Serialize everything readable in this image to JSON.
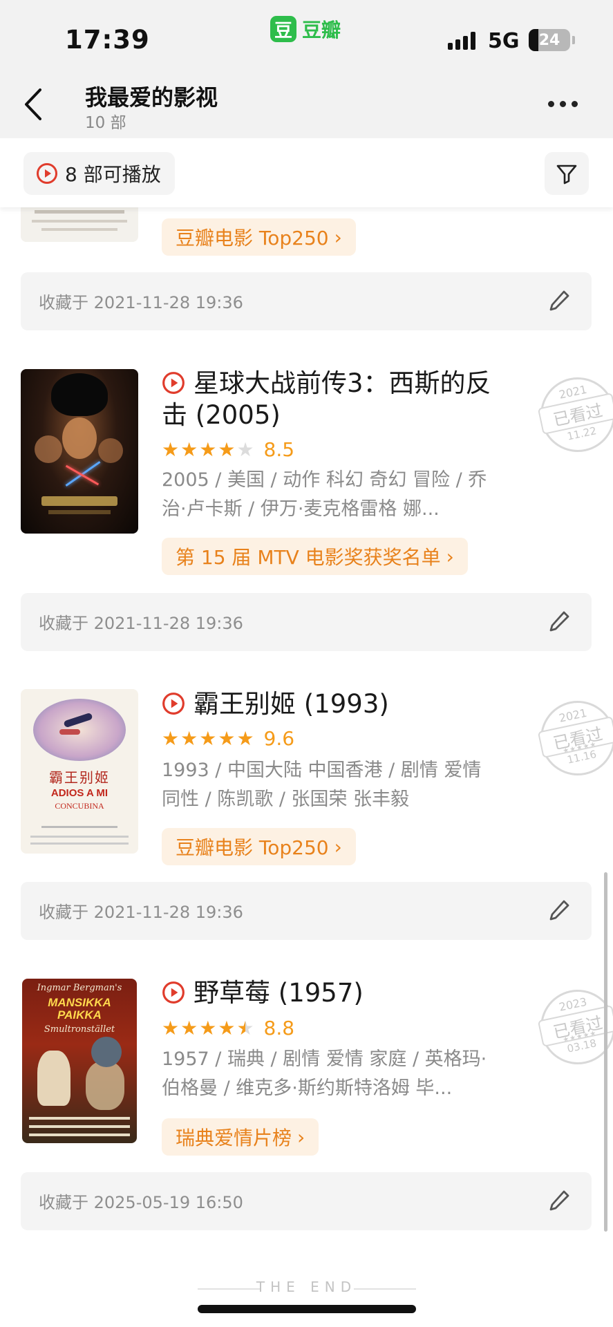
{
  "status_bar": {
    "time": "17:39",
    "app_logo_char": "豆",
    "app_name": "豆瓣",
    "network": "5G",
    "battery": "24"
  },
  "header": {
    "title": "我最爱的影视",
    "count": "10 部"
  },
  "toolbar": {
    "playable_label": "8 部可播放"
  },
  "colors": {
    "accent_red": "#e03c2c",
    "star_orange": "#f59b19",
    "tag_text": "#e8821c",
    "tag_bg": "#fdf1e3",
    "brand_green": "#2ebd4b"
  },
  "items": [
    {
      "tag": "豆瓣电影 Top250",
      "collected": "收藏于 2021-11-28 19:36"
    },
    {
      "title": "星球大战前传3：西斯的反击 (2005)",
      "rating_stars": 4,
      "score": "8.5",
      "meta": "2005 / 美国 / 动作 科幻 奇幻 冒险 / 乔治·卢卡斯 / 伊万·麦克格雷格 娜...",
      "tag": "第 15 届 MTV 电影奖获奖名单",
      "collected": "收藏于 2021-11-28 19:36",
      "stamp": {
        "year": "2021",
        "text": "已看过",
        "date": "11.22"
      }
    },
    {
      "title": "霸王别姬 (1993)",
      "rating_stars": 5,
      "score": "9.6",
      "meta": "1993 / 中国大陆 中国香港 / 剧情 爱情 同性 / 陈凯歌 / 张国荣 张丰毅",
      "tag": "豆瓣电影 Top250",
      "collected": "收藏于 2021-11-28 19:36",
      "poster_title_cn": "霸王别姬",
      "poster_title_en": "ADIOS A MI",
      "poster_subtitle": "CONCUBINA",
      "stamp": {
        "year": "2021",
        "text": "已看过",
        "date": "11.16"
      }
    },
    {
      "title": "野草莓 (1957)",
      "rating_stars": 4.5,
      "score": "8.8",
      "meta": "1957 / 瑞典 / 剧情 爱情 家庭 / 英格玛·伯格曼 / 维克多·斯约斯特洛姆 毕...",
      "tag": "瑞典爱情片榜",
      "collected": "收藏于 2025-05-19 16:50",
      "poster_top": "Ingmar Bergman's",
      "poster_title": "MANSIKKA PAIKKA",
      "poster_sub": "Smultronstället",
      "stamp": {
        "year": "2023",
        "text": "已看过",
        "date": "03.18"
      }
    }
  ],
  "footer": {
    "the_end": "THE END"
  }
}
